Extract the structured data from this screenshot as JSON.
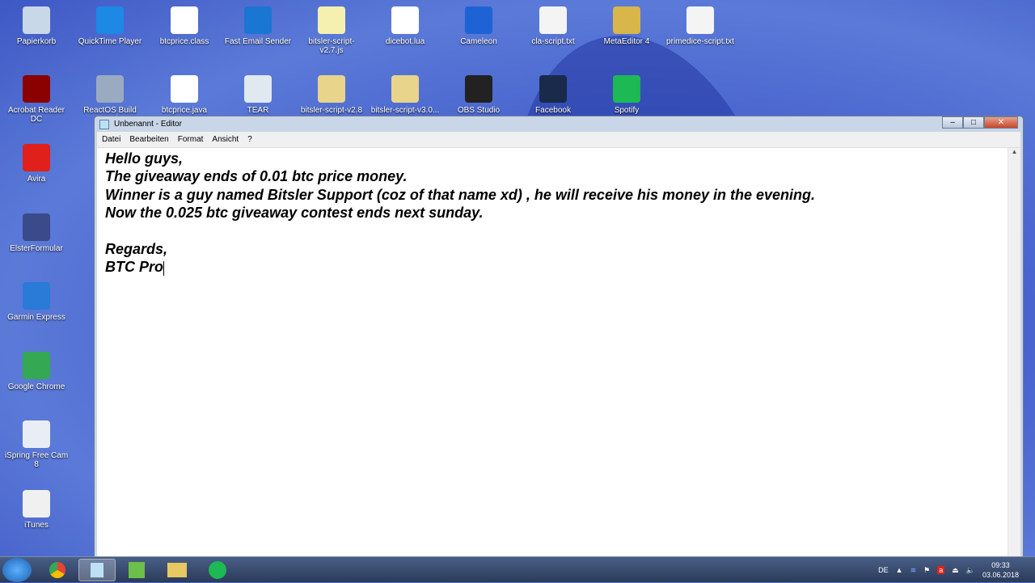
{
  "desktop": {
    "top_row": [
      {
        "label": "Papierkorb",
        "icon": "recycle-bin-icon",
        "color": "#c8d8e8"
      },
      {
        "label": "QuickTime Player",
        "icon": "quicktime-icon",
        "color": "#1e88e5"
      },
      {
        "label": "btcprice.class",
        "icon": "file-icon",
        "color": "#ffffff"
      },
      {
        "label": "Fast Email Sender",
        "icon": "email-sender-icon",
        "color": "#1976d2"
      },
      {
        "label": "bitsler-script-v2.7.js",
        "icon": "script-icon",
        "color": "#f5f0b0"
      },
      {
        "label": "dicebot.lua",
        "icon": "vscode-file-icon",
        "color": "#ffffff"
      },
      {
        "label": "Cameleon",
        "icon": "cameleon-icon",
        "color": "#1e63d6"
      },
      {
        "label": "cla-script.txt",
        "icon": "text-file-icon",
        "color": "#f4f4f4"
      },
      {
        "label": "MetaEditor 4",
        "icon": "metaeditor-icon",
        "color": "#d8b64a"
      },
      {
        "label": "primedice-script.txt",
        "icon": "text-file-icon",
        "color": "#f4f4f4"
      }
    ],
    "second_row": [
      {
        "label": "Acrobat Reader DC",
        "icon": "acrobat-icon",
        "color": "#8b0000"
      },
      {
        "label": "ReactOS Build Envi",
        "icon": "reactos-icon",
        "color": "#9aaac0"
      },
      {
        "label": "btcprice.java",
        "icon": "vscode-file-icon",
        "color": "#ffffff"
      },
      {
        "label": "TEAR",
        "icon": "water-drop-icon",
        "color": "#e0e8f0"
      },
      {
        "label": "bitsler-script-v2.8",
        "icon": "folder-icon",
        "color": "#e8d48a"
      },
      {
        "label": "bitsler-script-v3.0...",
        "icon": "folder-icon",
        "color": "#e8d48a"
      },
      {
        "label": "OBS Studio",
        "icon": "obs-icon",
        "color": "#222222"
      },
      {
        "label": "Facebook",
        "icon": "facebook-app-icon",
        "color": "#1a2a4a"
      },
      {
        "label": "Spotify",
        "icon": "spotify-icon",
        "color": "#1db954"
      }
    ],
    "left_column": [
      {
        "label": "Avira",
        "icon": "avira-icon",
        "color": "#e0201a"
      },
      {
        "label": "ElsterFormular",
        "icon": "elster-icon",
        "color": "#3a4a8a"
      },
      {
        "label": "Garmin Express",
        "icon": "garmin-icon",
        "color": "#2a7ad8"
      },
      {
        "label": "Google Chrome",
        "icon": "chrome-icon",
        "color": "#34a853"
      },
      {
        "label": "iSpring Free Cam 8",
        "icon": "ispring-icon",
        "color": "#e8eef4"
      },
      {
        "label": "iTunes",
        "icon": "itunes-icon",
        "color": "#f0f0f0"
      }
    ]
  },
  "notepad": {
    "title": "Unbenannt - Editor",
    "menu": [
      "Datei",
      "Bearbeiten",
      "Format",
      "Ansicht",
      "?"
    ],
    "text": "Hello guys,\nThe giveaway ends of 0.01 btc price money.\nWinner is a guy named Bitsler Support (coz of that name xd) , he will receive his money in the evening.\nNow the 0.025 btc giveaway contest ends next sunday.\n\nRegards,\nBTC Pro"
  },
  "taskbar": {
    "language": "DE",
    "time": "09:33",
    "date": "03.06.2018"
  }
}
